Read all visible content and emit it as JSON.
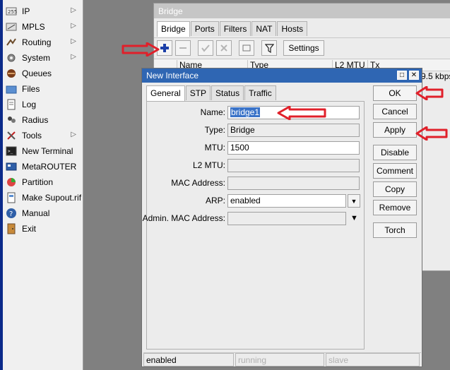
{
  "sidebar": {
    "items": [
      {
        "label": "IP",
        "icon": "ip-icon",
        "submenu": true
      },
      {
        "label": "MPLS",
        "icon": "mpls-icon",
        "submenu": true
      },
      {
        "label": "Routing",
        "icon": "routing-icon",
        "submenu": true
      },
      {
        "label": "System",
        "icon": "gear-icon",
        "submenu": true
      },
      {
        "label": "Queues",
        "icon": "queues-icon",
        "submenu": false
      },
      {
        "label": "Files",
        "icon": "folder-icon",
        "submenu": false
      },
      {
        "label": "Log",
        "icon": "log-icon",
        "submenu": false
      },
      {
        "label": "Radius",
        "icon": "radius-icon",
        "submenu": false
      },
      {
        "label": "Tools",
        "icon": "tools-icon",
        "submenu": true
      },
      {
        "label": "New Terminal",
        "icon": "terminal-icon",
        "submenu": false
      },
      {
        "label": "MetaROUTER",
        "icon": "metarouter-icon",
        "submenu": false
      },
      {
        "label": "Partition",
        "icon": "partition-icon",
        "submenu": false
      },
      {
        "label": "Make Supout.rif",
        "icon": "supout-icon",
        "submenu": false
      },
      {
        "label": "Manual",
        "icon": "help-icon",
        "submenu": false
      },
      {
        "label": "Exit",
        "icon": "exit-icon",
        "submenu": false
      }
    ]
  },
  "bridge_window": {
    "title": "Bridge",
    "tabs": [
      "Bridge",
      "Ports",
      "Filters",
      "NAT",
      "Hosts"
    ],
    "settings_label": "Settings",
    "columns": [
      "Name",
      "Type",
      "L2 MTU",
      "Tx"
    ],
    "tx_value": "9.5 kbps"
  },
  "dialog": {
    "title": "New Interface",
    "tabs": [
      "General",
      "STP",
      "Status",
      "Traffic"
    ],
    "fields": {
      "name_label": "Name:",
      "name_value": "bridge1",
      "type_label": "Type:",
      "type_value": "Bridge",
      "mtu_label": "MTU:",
      "mtu_value": "1500",
      "l2mtu_label": "L2 MTU:",
      "l2mtu_value": "",
      "mac_label": "MAC Address:",
      "mac_value": "",
      "arp_label": "ARP:",
      "arp_value": "enabled",
      "admin_mac_label": "Admin. MAC Address:",
      "admin_mac_value": ""
    },
    "buttons": {
      "ok": "OK",
      "cancel": "Cancel",
      "apply": "Apply",
      "disable": "Disable",
      "comment": "Comment",
      "copy": "Copy",
      "remove": "Remove",
      "torch": "Torch"
    },
    "status": [
      "enabled",
      "running",
      "slave"
    ]
  },
  "colors": {
    "annotation_arrow": "#e0202a",
    "title_active": "#2f66b3",
    "selection": "#3a73c8"
  }
}
